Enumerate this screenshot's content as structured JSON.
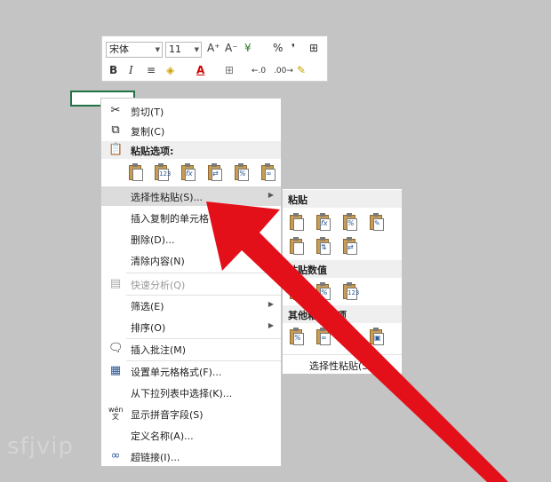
{
  "minibar": {
    "font_name": "宋体",
    "font_size": "11",
    "buttons_row1": [
      "A⁺",
      "A⁻",
      "¥",
      "%",
      "❜",
      "⊞"
    ],
    "buttons_row2": [
      "B",
      "I",
      "≡",
      "◈",
      "A",
      "⊞",
      "←.0",
      ".00→",
      "✎"
    ]
  },
  "menu": {
    "cut": "剪切(T)",
    "copy": "复制(C)",
    "paste_options_header": "粘贴选项:",
    "paste_special": "选择性粘贴(S)...",
    "insert_copied": "插入复制的单元格",
    "delete": "删除(D)...",
    "clear": "清除内容(N)",
    "quick_analysis": "快速分析(Q)",
    "filter": "筛选(E)",
    "sort": "排序(O)",
    "insert_comment": "插入批注(M)",
    "format_cells": "设置单元格格式(F)...",
    "pick_from_list": "从下拉列表中选择(K)...",
    "phonetic": "显示拼音字段(S)",
    "define_name": "定义名称(A)...",
    "hyperlink": "超链接(I)..."
  },
  "submenu": {
    "paste_header": "粘贴",
    "paste_values_header": "粘贴数值",
    "other_header": "其他粘贴选项",
    "footer": "选择性粘贴(S)..."
  },
  "icons": {
    "paste_option_marks": [
      "",
      "123",
      "fx",
      "⇄",
      "%",
      "∞"
    ],
    "paste_marks": [
      "",
      "fx",
      "%",
      "✎",
      "",
      "⇅",
      "⇄"
    ],
    "values_marks": [
      "",
      "%",
      "123"
    ],
    "other_marks": [
      "%",
      "∞",
      "",
      "▣"
    ]
  },
  "watermark": "sfjvip",
  "colors": {
    "arrow": "#e3101a",
    "background": "#c4c4c4",
    "cell_border": "#217346"
  }
}
